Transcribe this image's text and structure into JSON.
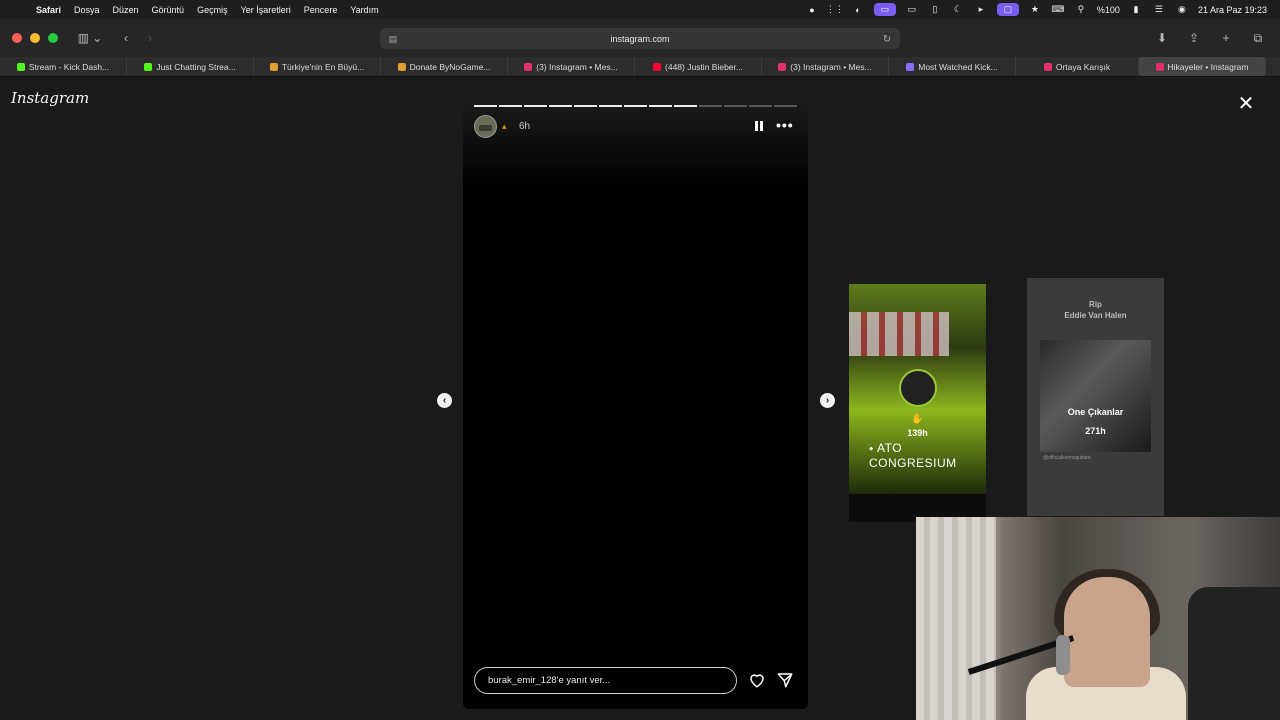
{
  "menubar": {
    "items": [
      "Safari",
      "Dosya",
      "Düzen",
      "Görüntü",
      "Geçmiş",
      "Yer İşaretleri",
      "Pencere",
      "Yardım"
    ],
    "battery": "%100",
    "datetime": "21 Ara Paz  19:23"
  },
  "toolbar": {
    "address": "instagram.com"
  },
  "tabs": [
    {
      "label": "Stream - Kick Dash...",
      "color": "#53fc18"
    },
    {
      "label": "Just Chatting Strea...",
      "color": "#53fc18"
    },
    {
      "label": "Türkiye'nin En Büyü...",
      "color": "#e0a030"
    },
    {
      "label": "Donate ByNoGame...",
      "color": "#e0a030"
    },
    {
      "label": "(3) Instagram • Mes...",
      "color": "#e1306c"
    },
    {
      "label": "(448) Justin Bieber...",
      "color": "#ff0033"
    },
    {
      "label": "(3) Instagram • Mes...",
      "color": "#e1306c"
    },
    {
      "label": "Most Watched Kick...",
      "color": "#8a6cff"
    },
    {
      "label": "Ortaya Karışık",
      "color": "#e1306c"
    },
    {
      "label": "Hikayeler • Instagram",
      "color": "#e1306c"
    }
  ],
  "instagram": {
    "logo": "Instagram",
    "story": {
      "time": "6h",
      "reply_placeholder": "burak_emir_128'e yanıt ver...",
      "progress": {
        "total": 13,
        "viewed": 9
      }
    },
    "previews": [
      {
        "time": "139h",
        "location": "ATO CONGRESIUM"
      },
      {
        "title_line1": "Rip",
        "title_line2": "Eddie Van Halen",
        "name": "One Çıkanlar",
        "time": "271h",
        "caption": "@officialkennsguitars"
      }
    ]
  }
}
